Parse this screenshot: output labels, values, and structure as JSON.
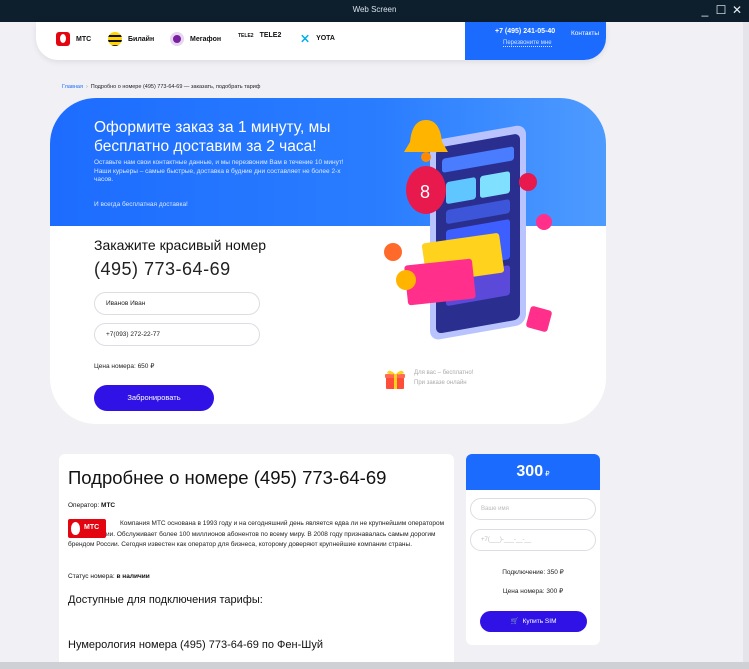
{
  "window": {
    "title": "Web Screen",
    "controls": [
      "_",
      "☐",
      "✕"
    ]
  },
  "operators": [
    {
      "name": "МТС",
      "color": "#e30611",
      "icon": "mts-logo-icon"
    },
    {
      "name": "Билайн",
      "color": "#ffd400",
      "icon": "beeline-logo-icon"
    },
    {
      "name": "Мегафон",
      "color": "#7b1fa2",
      "icon": "megafon-logo-icon"
    },
    {
      "name": "TELE2",
      "color": "#111111",
      "icon": "tele2-logo-icon",
      "logo_text": "TELE2"
    },
    {
      "name": "YOTA",
      "color": "#00aeef",
      "icon": "yota-logo-icon"
    }
  ],
  "header": {
    "phone": "+7 (495) 241-05-40",
    "callback": "Перезвоните мне",
    "contacts": "Контакты"
  },
  "breadcrumb": {
    "home": "Главная",
    "separator": "›",
    "current": "Подробно о номере (495) 773-64-69 — заказать, подобрать тариф"
  },
  "hero": {
    "title": "Оформите заказ за 1 минуту, мы бесплатно доставим за 2 часа!",
    "lead": "Оставьте нам свои контактные данные, и мы перезвоним Вам в течение 10 минут! Наши курьеры – самые быстрые, доставка в будние дни составляет не более 2-х часов.",
    "free_delivery": "И всегда бесплатная доставка!",
    "order_title": "Закажите красивый номер",
    "number": "(495) 773-64-69",
    "name_value": "Иванов Иван",
    "phone_value": "+7(093) 272-22-77",
    "price": "Цена номера: 650 ₽",
    "book_button": "Забронировать",
    "gift_line1": "Для вас – бесплатно!",
    "gift_line2": "При заказе онлайн"
  },
  "details": {
    "title": "Подробнее о номере (495) 773-64-69",
    "operator_label": "Оператор:",
    "operator_value": "МТС",
    "logo_text": "МТС",
    "description": "Компания МТС основана в 1993 году и на сегодняшний день является едва ли не крупнейшим оператором связи в России. Обслуживает более 100 миллионов абонентов по всему миру. В 2008 году признавалась самым дорогим брендом России. Сегодня известен как оператор для бизнеса, которому доверяют крупнейшие компании страны.",
    "status_label": "Статус номера:",
    "status_value": "в наличии",
    "tariffs_title": "Доступные для подключения тарифы:",
    "numerology_title": "Нумерология номера (495) 773-64-69 по Фен-Шуй"
  },
  "order_card": {
    "price": "300",
    "currency": "₽",
    "name_placeholder": "Ваше имя",
    "phone_placeholder": "+7(___)-___-__-__",
    "connection": "Подключение: 350 ₽",
    "number_price": "Цена номера: 300 ₽",
    "buy_button": "Купить SIM"
  },
  "colors": {
    "accent_blue": "#1b6bff",
    "button_purple": "#3112e6",
    "mts_red": "#e30611"
  }
}
